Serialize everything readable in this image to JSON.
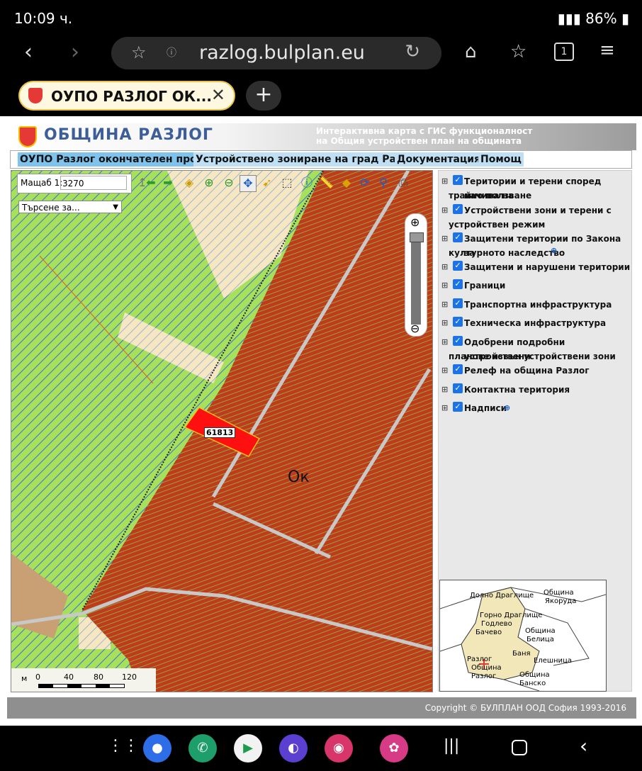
{
  "status_bar": {
    "time": "10:09 ч.",
    "battery": "86%"
  },
  "browser": {
    "url": "razlog.bulplan.eu",
    "tab_title": "ОУПО РАЗЛОГ ОК...",
    "new_tab": "+"
  },
  "site": {
    "title": "ОБЩИНА РАЗЛОГ",
    "subtitle_1": "Интерактивна карта с ГИС функционалност",
    "subtitle_2": "на Общия устройствен план на общината",
    "menu": [
      "ОУПО Разлог окончателен проект",
      "Устройствено зониране на град Разлог",
      "Документация",
      "Помощ"
    ]
  },
  "map": {
    "scale_label": "Мащаб 1:",
    "scale_value": "3270",
    "search_placeholder": "Търсене за...",
    "parcel_label": "61813",
    "zone_label": "Ок",
    "scalebar_unit": "м",
    "scalebar_ticks": [
      "0",
      "40",
      "80",
      "120"
    ]
  },
  "layers": [
    {
      "line1": "Територии и терени според начина на",
      "line2": "трайно ползване",
      "checked": true
    },
    {
      "line1": "Устройствени зони и терени с",
      "line2": "устройствен режим",
      "checked": true
    },
    {
      "line1": "Защитени територии по Закона за",
      "line2": "културното наследство",
      "checked": true
    },
    {
      "line1": "Защитени и нарушени територии",
      "line2": "",
      "checked": true
    },
    {
      "line1": "Граници",
      "line2": "",
      "checked": true
    },
    {
      "line1": "Транспортна инфраструктура",
      "line2": "",
      "checked": true
    },
    {
      "line1": "Техническа инфраструктура",
      "line2": "",
      "checked": true
    },
    {
      "line1": "Одобрени подробни устройствени",
      "line2": "планове извън устройствени зони",
      "checked": true
    },
    {
      "line1": "Релеф на община Разлог",
      "line2": "",
      "checked": true
    },
    {
      "line1": "Контактна територия",
      "line2": "",
      "checked": true
    },
    {
      "line1": "Надписи",
      "line2": "",
      "checked": true
    }
  ],
  "minimap": {
    "labels": [
      "Долно Драглище",
      "Община",
      "Якоруда",
      "Горно Драглище",
      "Годлево",
      "Бачево",
      "Община",
      "Белица",
      "Баня",
      "Елешница",
      "Разлог",
      "Община",
      "Разлог",
      "Община",
      "Банско"
    ]
  },
  "footer": {
    "copyright": "Copyright © БУЛПЛАН ООД София 1993-2016"
  },
  "colors": {
    "zone_red": "#c23a1c",
    "zone_green": "#a7e05a",
    "menu_bg": "#bfe0f4",
    "title_blue": "#3c5f9a"
  }
}
